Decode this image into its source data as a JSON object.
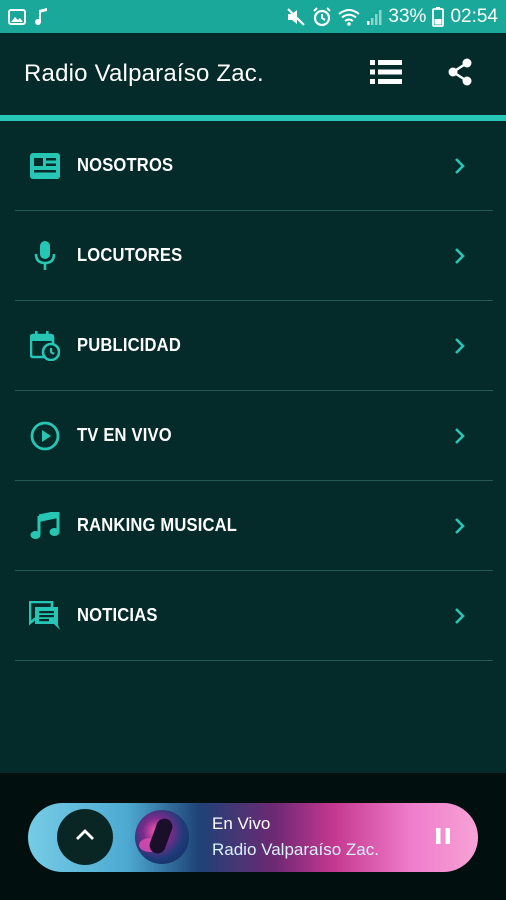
{
  "status_bar": {
    "battery_percent": "33%",
    "time": "02:54",
    "left_icons": [
      "gallery-icon",
      "music-note-icon"
    ],
    "right_icons": [
      "mute-icon",
      "alarm-icon",
      "wifi-icon",
      "signal-icon",
      "battery-icon"
    ]
  },
  "app_bar": {
    "title": "Radio Valparaíso Zac.",
    "actions": [
      "list-icon",
      "share-icon"
    ]
  },
  "menu": {
    "items": [
      {
        "label": "NOSOTROS",
        "icon": "newspaper-icon"
      },
      {
        "label": "LOCUTORES",
        "icon": "microphone-icon"
      },
      {
        "label": "PUBLICIDAD",
        "icon": "calendar-clock-icon"
      },
      {
        "label": "TV EN VIVO",
        "icon": "play-circle-icon"
      },
      {
        "label": "RANKING MUSICAL",
        "icon": "music-icon"
      },
      {
        "label": "NOTICIAS",
        "icon": "chat-icon"
      }
    ]
  },
  "player": {
    "status": "En Vivo",
    "station": "Radio Valparaíso Zac."
  },
  "colors": {
    "accent": "#27c6b4",
    "status_bar": "#1aa89a",
    "background": "#042a29"
  }
}
